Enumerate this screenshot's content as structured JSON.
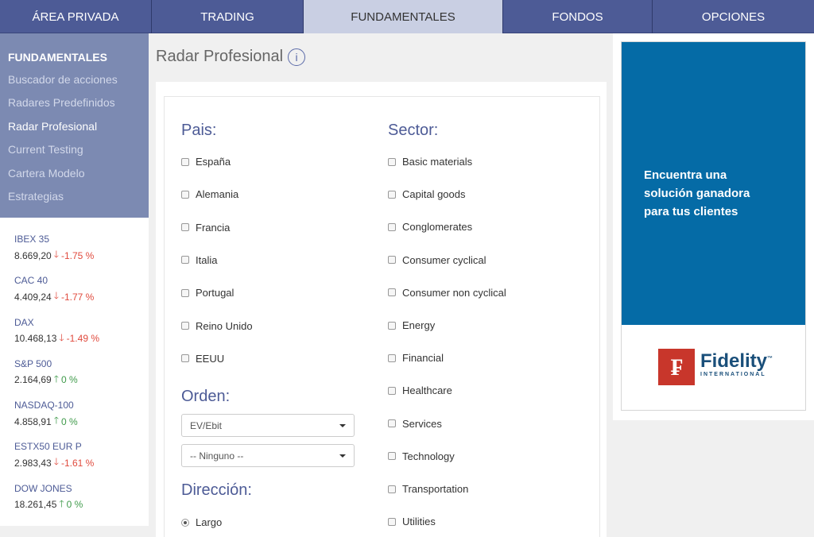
{
  "nav": [
    {
      "label": "ÁREA PRIVADA",
      "active": false
    },
    {
      "label": "TRADING",
      "active": false
    },
    {
      "label": "FUNDAMENTALES",
      "active": true
    },
    {
      "label": "FONDOS",
      "active": false
    },
    {
      "label": "OPCIONES",
      "active": false
    }
  ],
  "sidebar": {
    "heading": "FUNDAMENTALES",
    "items": [
      "Buscador de acciones",
      "Radares Predefinidos",
      "Radar Profesional",
      "Current Testing",
      "Cartera Modelo",
      "Estrategias"
    ]
  },
  "indices": [
    {
      "name": "IBEX 35",
      "value": "8.669,20",
      "change": "-1.75 %",
      "dir": "down"
    },
    {
      "name": "CAC 40",
      "value": "4.409,24",
      "change": "-1.77 %",
      "dir": "down"
    },
    {
      "name": "DAX",
      "value": "10.468,13",
      "change": "-1.49 %",
      "dir": "down"
    },
    {
      "name": "S&P 500",
      "value": "2.164,69",
      "change": "0 %",
      "dir": "up"
    },
    {
      "name": "NASDAQ-100",
      "value": "4.858,91",
      "change": "0 %",
      "dir": "up"
    },
    {
      "name": "ESTX50 EUR P",
      "value": "2.983,43",
      "change": "-1.61 %",
      "dir": "down"
    },
    {
      "name": "DOW JONES",
      "value": "18.261,45",
      "change": "0 %",
      "dir": "up"
    }
  ],
  "page": {
    "title": "Radar Profesional",
    "info_icon": "i"
  },
  "form": {
    "pais_label": "Pais:",
    "paises": [
      "España",
      "Alemania",
      "Francia",
      "Italia",
      "Portugal",
      "Reino Unido",
      "EEUU"
    ],
    "sector_label": "Sector:",
    "sectores": [
      "Basic materials",
      "Capital goods",
      "Conglomerates",
      "Consumer cyclical",
      "Consumer non cyclical",
      "Energy",
      "Financial",
      "Healthcare",
      "Services",
      "Technology",
      "Transportation",
      "Utilities"
    ],
    "orden_label": "Orden:",
    "orden_select1": "EV/Ebit",
    "orden_select2": "-- Ninguno --",
    "direccion_label": "Dirección:",
    "direccion_option": "Largo"
  },
  "ad": {
    "line1": "Encuentra una",
    "line2": "solución ganadora",
    "line3": "para tus clientes",
    "brand": "Fidelity",
    "brand_tm": "™",
    "brand_sub": "INTERNATIONAL",
    "colors": {
      "ad_bg": "#056ba6",
      "logo_red": "#c8362b"
    }
  },
  "colors": {
    "nav": "#4d5b96",
    "sidebar": "#7c8ab2",
    "down": "#e04a3d",
    "up": "#3f9a4a"
  }
}
